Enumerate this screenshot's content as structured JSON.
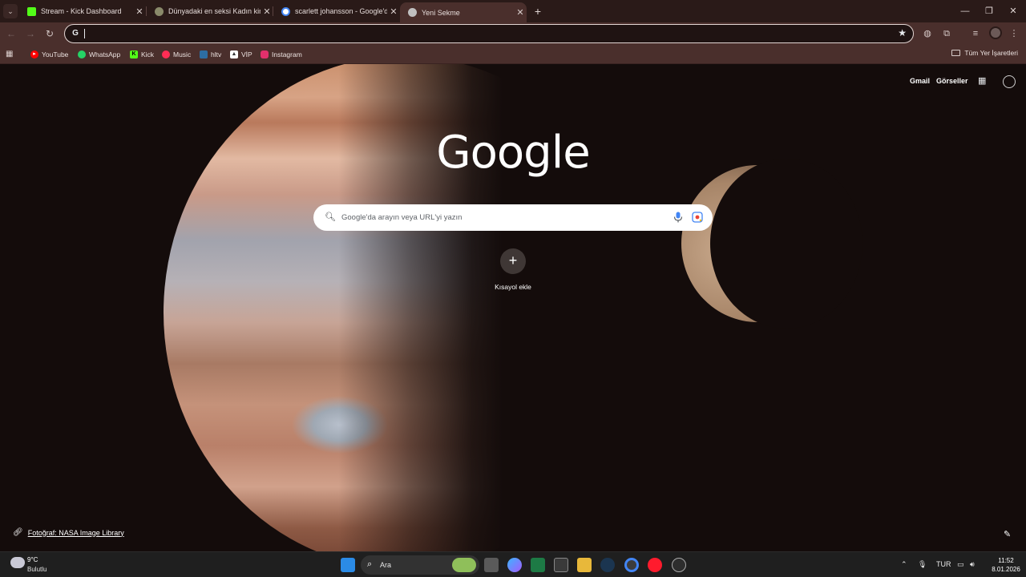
{
  "browser": {
    "tabs": [
      {
        "title": "Stream - Kick Dashboard",
        "icon": "kick-icon",
        "color": "#53fc18"
      },
      {
        "title": "Dünyadaki en seksi Kadın kim",
        "icon": "ai-chat-icon",
        "color": "#8a8a6a"
      },
      {
        "title": "scarlett johansson - Google'da",
        "icon": "google-icon",
        "color": "#4285f4"
      },
      {
        "title": "Yeni Sekme",
        "icon": "chrome-newtab-icon",
        "color": "#c0c0c0"
      }
    ],
    "active_tab": 3,
    "omnibox_value": "",
    "bookmarks": [
      {
        "label": "YouTube",
        "icon": "youtube-icon",
        "color": "#ff0000"
      },
      {
        "label": "WhatsApp",
        "icon": "whatsapp-icon",
        "color": "#25d366"
      },
      {
        "label": "Kick",
        "icon": "kick-icon",
        "color": "#53fc18"
      },
      {
        "label": "Music",
        "icon": "music-icon",
        "color": "#ff2d55"
      },
      {
        "label": "hltv",
        "icon": "hltv-icon",
        "color": "#2d6da3"
      },
      {
        "label": "VİP",
        "icon": "vip-icon",
        "color": "#ffffff"
      },
      {
        "label": "Instagram",
        "icon": "instagram-icon",
        "color": "#e1306c"
      }
    ],
    "all_bookmarks_label": "Tüm Yer İşaretleri"
  },
  "ntp": {
    "top_links": {
      "gmail": "Gmail",
      "images": "Görseller"
    },
    "logo_text": "Google",
    "search_placeholder": "Google'da arayın veya URL'yi yazın",
    "shortcut_label": "Kısayol ekle",
    "photo_credit": "Fotoğraf: NASA Image Library"
  },
  "taskbar": {
    "weather_temp": "9°C",
    "weather_desc": "Bulutlu",
    "search_label": "Ara",
    "language": "TUR",
    "time": "11:52",
    "date": "8.01.2026"
  }
}
